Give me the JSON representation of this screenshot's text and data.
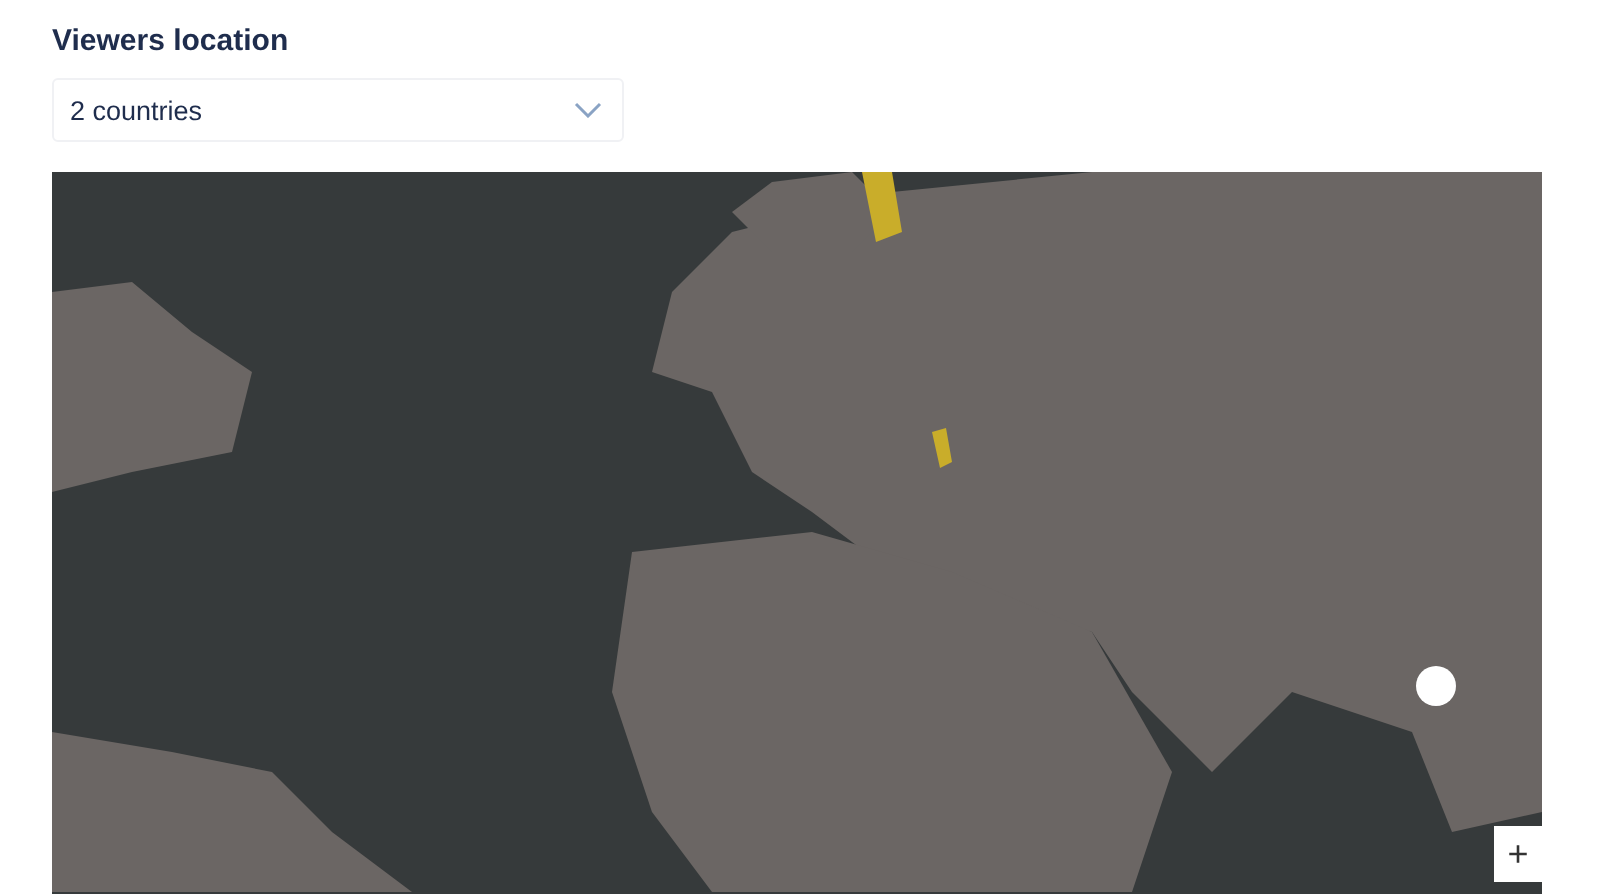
{
  "title": "Viewers location",
  "dropdown": {
    "value": "2 countries"
  },
  "map": {
    "zoom_in": "+"
  }
}
